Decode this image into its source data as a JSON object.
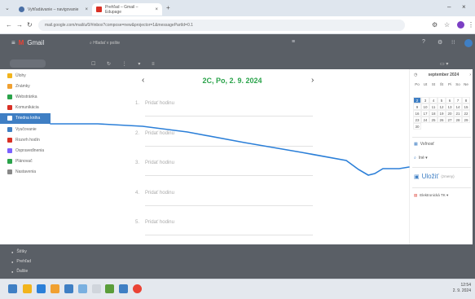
{
  "browser": {
    "tabs": [
      {
        "label": "Vyhľadávanie – navigovanie",
        "color": "#4a6fa5"
      },
      {
        "label": "Prehľad – Gmail – Edupage",
        "color": "#d93025"
      }
    ],
    "new_tab_label": "+",
    "url": "mail.google.com/mail/u/0/#inbox?compose=new&projector=1&messagePartId=0.1",
    "window_controls": [
      "–",
      "×"
    ]
  },
  "gmail": {
    "logo_label": "Gmail",
    "search_placeholder": "Hľadať v pošte",
    "sidebar": [
      {
        "label": "Úlohy",
        "color": "#f2b41c",
        "icon": "star-icon"
      },
      {
        "label": "Známky",
        "color": "#f0a030",
        "icon": "grade-icon"
      },
      {
        "label": "Webstránka",
        "color": "#2aa34a",
        "icon": "web-icon"
      },
      {
        "label": "Komunikácia",
        "color": "#d93025",
        "icon": "chat-icon"
      },
      {
        "label": "Triedna kniha",
        "color": "#3f7fc4",
        "icon": "book-icon"
      },
      {
        "label": "Vyučovanie",
        "color": "#3f7fc4",
        "icon": "class-icon"
      },
      {
        "label": "Rozvrh hodín",
        "color": "#d93025",
        "icon": "timetable-icon"
      },
      {
        "label": "Ospravedlnenia",
        "color": "#7b61ff",
        "icon": "excuse-icon"
      },
      {
        "label": "Plánovač",
        "color": "#2aa34a",
        "icon": "planner-icon"
      },
      {
        "label": "Nastavenia",
        "color": "#888888",
        "icon": "gear-icon"
      }
    ],
    "bottom_items": [
      "Štítky",
      "Prehľad",
      "Ďalšie"
    ]
  },
  "lesson_panel": {
    "date_title": "2C, Po, 2. 9. 2024",
    "prev_label": "‹",
    "next_label": "›",
    "lessons": [
      {
        "num": "1.",
        "label": "Pridať hodinu"
      },
      {
        "num": "2.",
        "label": "Pridať hodinu"
      },
      {
        "num": "3.",
        "label": "Pridať hodinu"
      },
      {
        "num": "4.",
        "label": "Pridať hodinu"
      },
      {
        "num": "5.",
        "label": "Pridať hodinu"
      }
    ]
  },
  "calendar": {
    "month_label": "september 2024",
    "weekdays": [
      "Po",
      "Ut",
      "St",
      "Št",
      "Pi",
      "So",
      "Ne"
    ],
    "weeks": [
      [
        "2",
        "3",
        "4",
        "5",
        "6",
        "7",
        "8"
      ],
      [
        "9",
        "10",
        "11",
        "12",
        "13",
        "14",
        "15"
      ],
      [
        "16",
        "17",
        "18",
        "19",
        "20",
        "21",
        "22"
      ],
      [
        "23",
        "24",
        "25",
        "26",
        "27",
        "28",
        "29"
      ],
      [
        "30",
        "",
        "",
        "",
        "",
        "",
        ""
      ]
    ],
    "selected_day": "2"
  },
  "right_panel": {
    "option1": "Voľnosť",
    "option2": "Iné ▾",
    "save_label": "Uložiť",
    "save_suffix": "(zmeny)",
    "bottom_link": "Elektronická TK ▾"
  },
  "taskbar": {
    "time": "12:54",
    "date": "2. 9. 2024"
  },
  "annotation": {
    "stroke_color": "#2b7fd8"
  }
}
